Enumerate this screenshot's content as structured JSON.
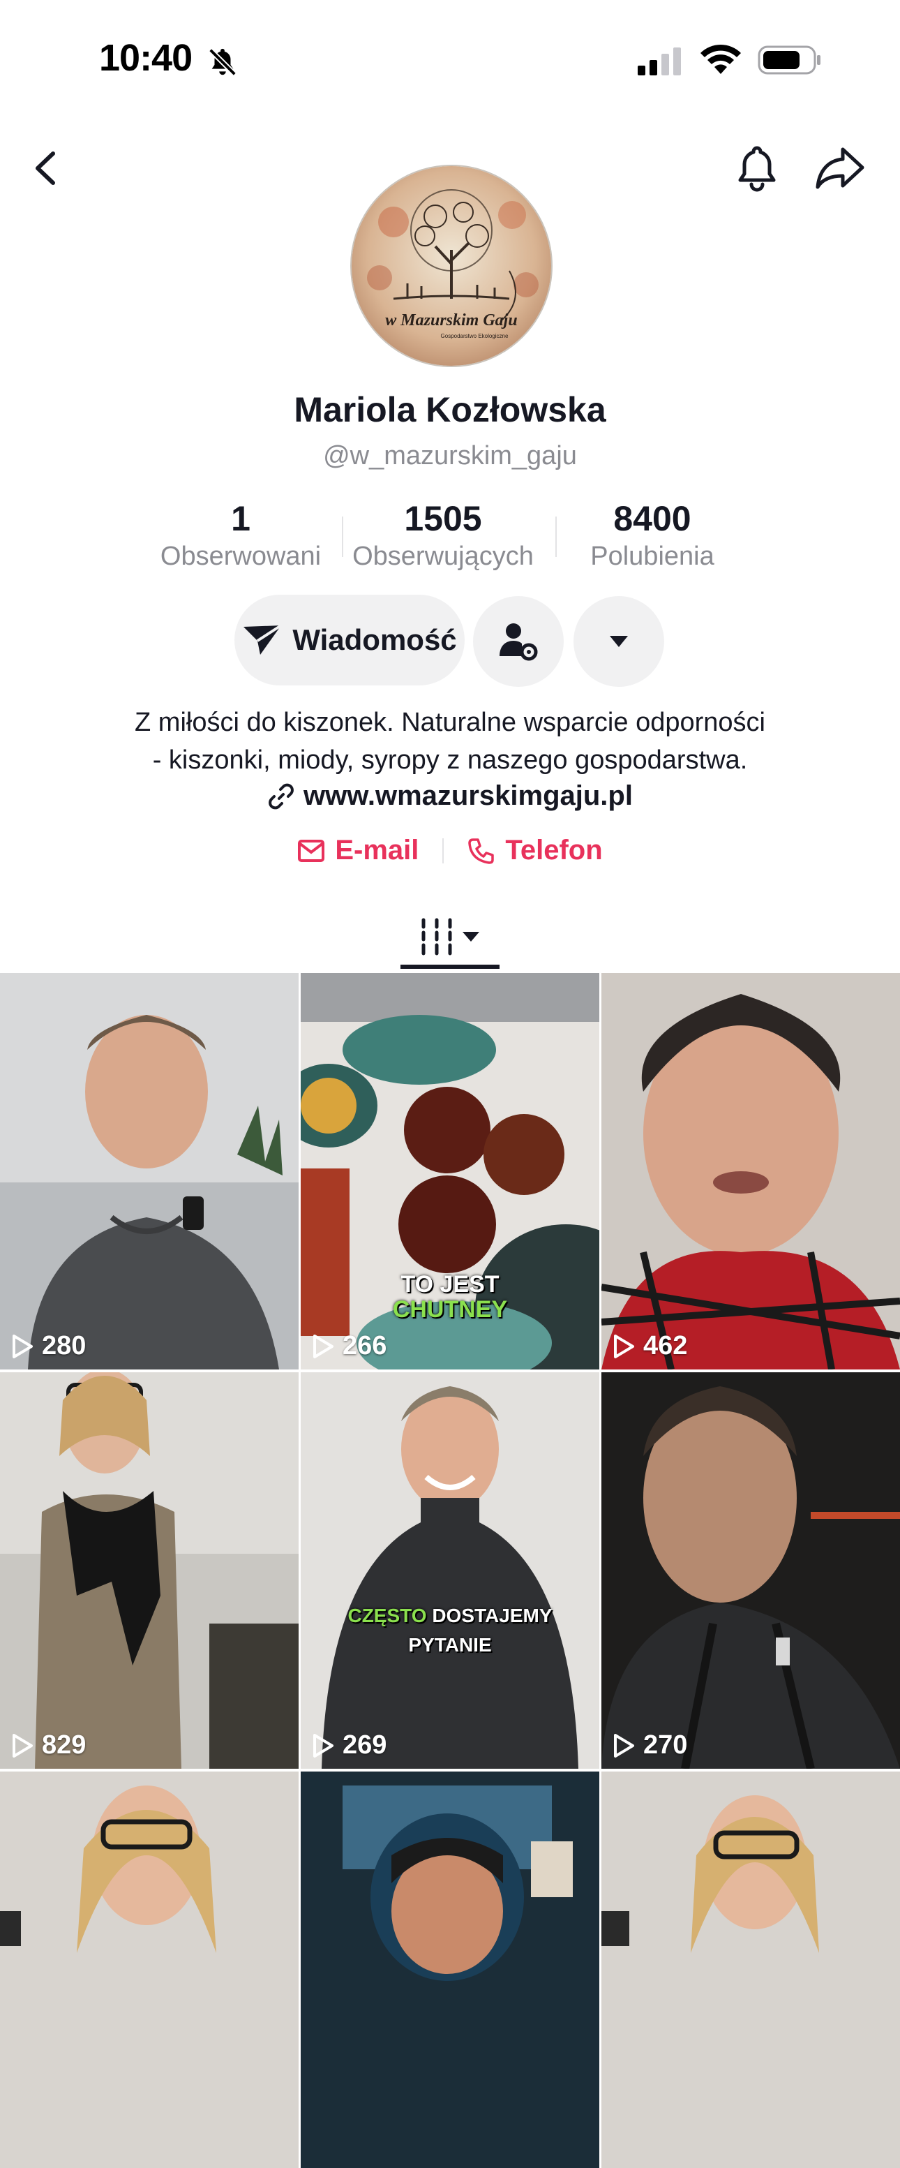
{
  "status_bar": {
    "time": "10:40"
  },
  "profile": {
    "name": "Mariola Kozłowska",
    "handle": "@w_mazurskim_gaju",
    "avatar_text": "w Mazurskim Gaju",
    "avatar_subtext": "Gospodarstwo Ekologiczne"
  },
  "stats": [
    {
      "value": "1",
      "label": "Obserwowani"
    },
    {
      "value": "1505",
      "label": "Obserwujących"
    },
    {
      "value": "8400",
      "label": "Polubienia"
    }
  ],
  "actions": {
    "message_label": "Wiadomość"
  },
  "bio": {
    "line1": "Z miłości do kiszonek. Naturalne wsparcie odporności",
    "line2": "- kiszonki, miody, syropy z naszego gospodarstwa.",
    "link": "www.wmazurskimgaju.pl",
    "email_label": "E-mail",
    "phone_label": "Telefon"
  },
  "videos": [
    {
      "views": "280",
      "overlay": ""
    },
    {
      "views": "266",
      "overlay_line1": "TO JEST",
      "overlay_line2": "CHUTNEY"
    },
    {
      "views": "462",
      "overlay": ""
    },
    {
      "views": "829",
      "overlay": ""
    },
    {
      "views": "269",
      "overlay_line1_a": "CZĘSTO",
      "overlay_line1_b": "DOSTAJEMY",
      "overlay_line2": "PYTANIE"
    },
    {
      "views": "270",
      "overlay": ""
    },
    {
      "views": "",
      "overlay": ""
    },
    {
      "views": "",
      "overlay": ""
    },
    {
      "views": "",
      "overlay": ""
    }
  ],
  "colors": {
    "accent": "#e8315b",
    "text": "#161823",
    "secondary": "#8a8b91",
    "button_bg": "#f1f1f2"
  }
}
